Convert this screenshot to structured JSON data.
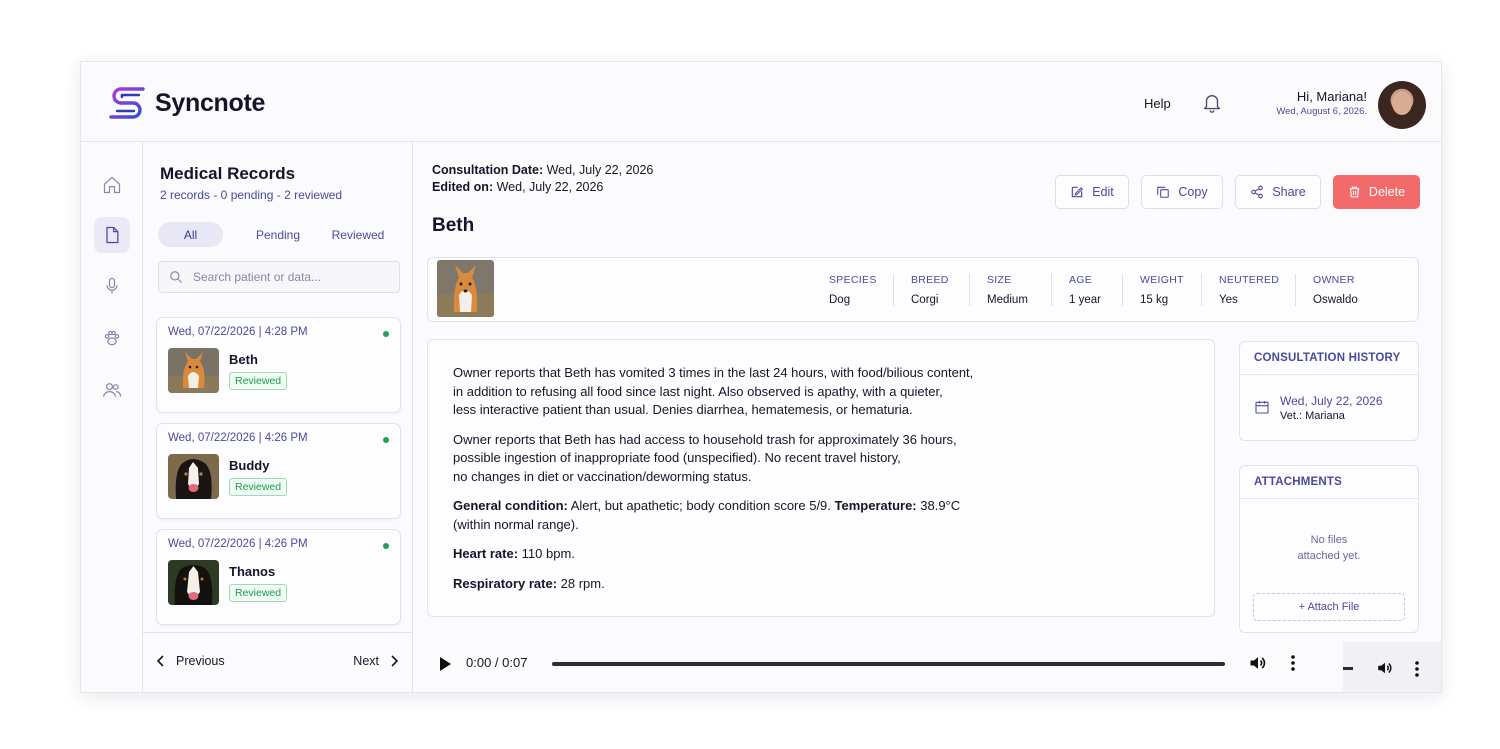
{
  "header": {
    "app_name": "Syncnote",
    "help": "Help",
    "greeting": "Hi, Mariana!",
    "date": "Wed, August 6, 2026."
  },
  "records": {
    "title": "Medical Records",
    "subtitle": "2 records - 0 pending - 2 reviewed",
    "tabs": [
      "All",
      "Pending",
      "Reviewed"
    ],
    "search_placeholder": "Search patient or data...",
    "items": [
      {
        "date": "Wed, 07/22/2026 | 4:28 PM",
        "name": "Beth",
        "status": "Reviewed"
      },
      {
        "date": "Wed, 07/22/2026 | 4:26 PM",
        "name": "Buddy",
        "status": "Reviewed"
      },
      {
        "date": "Wed, 07/22/2026 | 4:26 PM",
        "name": "Thanos",
        "status": "Reviewed"
      }
    ],
    "previous": "Previous",
    "next": "Next"
  },
  "consultation": {
    "date_label": "Consultation Date:",
    "date_value": "Wed, July 22, 2026",
    "edited_label": "Edited on:",
    "edited_value": "Wed, July 22, 2026",
    "patient": "Beth",
    "actions": {
      "edit": "Edit",
      "copy": "Copy",
      "share": "Share",
      "delete": "Delete"
    }
  },
  "patient_info": [
    {
      "label": "SPECIES",
      "value": "Dog"
    },
    {
      "label": "BREED",
      "value": "Corgi"
    },
    {
      "label": "SIZE",
      "value": "Medium"
    },
    {
      "label": "AGE",
      "value": "1 year"
    },
    {
      "label": "WEIGHT",
      "value": "15 kg"
    },
    {
      "label": "NEUTERED",
      "value": "Yes"
    },
    {
      "label": "OWNER",
      "value": "Oswaldo"
    }
  ],
  "notes": {
    "p1": "Owner reports that Beth has vomited 3 times in the last 24 hours, with food/bilious content,\nin addition to refusing all food since last night. Also observed is apathy, with a quieter,\nless interactive patient than usual. Denies diarrhea, hematemesis, or hematuria.",
    "p2": "Owner reports that Beth has had access to household trash for approximately 36 hours,\npossible ingestion of inappropriate food (unspecified). No recent travel history,\nno changes in diet or vaccination/deworming status.",
    "general_label": "General condition:",
    "general_text": " Alert, but apathetic; body condition score 5/9. ",
    "temp_label": "Temperature:",
    "temp_text": " 38.9°C\n(within normal range).",
    "hr_label": "Heart rate:",
    "hr_text": " 110 bpm.",
    "rr_label": "Respiratory rate:",
    "rr_text": " 28 rpm."
  },
  "history": {
    "title": "CONSULTATION HISTORY",
    "date": "Wed, July 22, 2026",
    "vet": "Vet.: Mariana"
  },
  "attachments": {
    "title": "ATTACHMENTS",
    "empty": "No files\nattached yet.",
    "attach": "+ Attach File"
  },
  "player": {
    "time": "0:00 / 0:07"
  }
}
